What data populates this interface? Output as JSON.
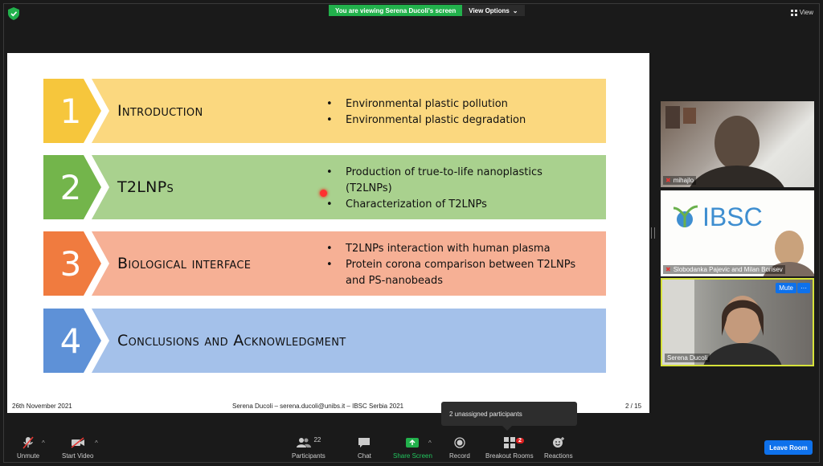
{
  "top_bar": {
    "banner_text": "You are viewing Serena Ducoli's screen",
    "view_options_label": "View Options",
    "view_label": "View"
  },
  "slide": {
    "sections": [
      {
        "number": "1",
        "title": "Introduction",
        "bullets": [
          "Environmental plastic pollution",
          "Environmental plastic degradation"
        ],
        "color": "#f6c63c",
        "band": "#fbd87f"
      },
      {
        "number": "2",
        "title": "T2LNPs",
        "bullets": [
          "Production of true-to-life nanoplastics",
          "(T2LNPs)",
          "Characterization of T2LNPs"
        ],
        "color": "#73b54b",
        "band": "#a9d18e"
      },
      {
        "number": "3",
        "title": "Biological interface",
        "bullets": [
          "T2LNPs interaction with human plasma",
          "Protein corona comparison between T2LNPs",
          "and PS-nanobeads"
        ],
        "color": "#f07b3f",
        "band": "#f6b095"
      },
      {
        "number": "4",
        "title": "Conclusions and Acknowledgment",
        "bullets": [],
        "color": "#5e91d7",
        "band": "#a4c1ea"
      }
    ],
    "footer": {
      "date": "26th November 2021",
      "author": "Serena Ducoli – serena.ducoli@unibs.it –   IBSC Serbia 2021",
      "page": "2 / 15"
    }
  },
  "tooltip": "2 unassigned participants",
  "participants": {
    "video1_name": "mihajlo",
    "video2_name": "Slobodanka Pajevic and Milan Borisev",
    "video2_logo": "IBSC",
    "video3_name": "Serena Ducoli",
    "mute_label": "Mute",
    "more_label": "···"
  },
  "toolbar": {
    "unmute": "Unmute",
    "start_video": "Start Video",
    "participants": "Participants",
    "participants_count": "22",
    "chat": "Chat",
    "share_screen": "Share Screen",
    "record": "Record",
    "breakout_rooms": "Breakout Rooms",
    "breakout_badge": "2",
    "reactions": "Reactions",
    "leave": "Leave Room"
  },
  "colors": {
    "accent": "#0e71eb",
    "share_green": "#22b14c",
    "active_speaker": "#d6e23a"
  }
}
